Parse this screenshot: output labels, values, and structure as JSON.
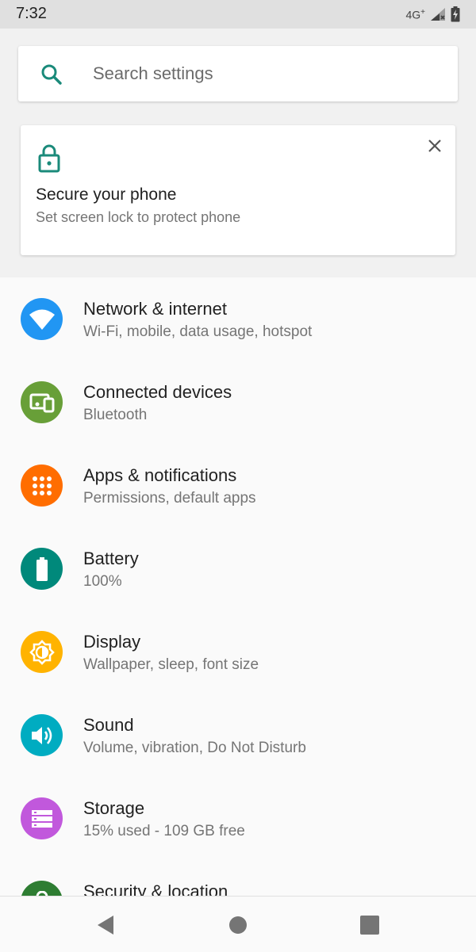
{
  "status_bar": {
    "time": "7:32",
    "network": "4G"
  },
  "search": {
    "placeholder": "Search settings",
    "icon": "search-icon"
  },
  "suggestion": {
    "icon": "lock-icon",
    "title": "Secure your phone",
    "subtitle": "Set screen lock to protect phone",
    "dismiss_icon": "close-icon"
  },
  "settings": [
    {
      "title": "Network & internet",
      "subtitle": "Wi-Fi, mobile, data usage, hotspot",
      "icon": "wifi-icon",
      "color": "#2196f3"
    },
    {
      "title": "Connected devices",
      "subtitle": "Bluetooth",
      "icon": "devices-icon",
      "color": "#689f38"
    },
    {
      "title": "Apps & notifications",
      "subtitle": "Permissions, default apps",
      "icon": "apps-grid-icon",
      "color": "#ff6d00"
    },
    {
      "title": "Battery",
      "subtitle": "100%",
      "icon": "battery-icon",
      "color": "#00897b"
    },
    {
      "title": "Display",
      "subtitle": "Wallpaper, sleep, font size",
      "icon": "brightness-icon",
      "color": "#ffb300"
    },
    {
      "title": "Sound",
      "subtitle": "Volume, vibration, Do Not Disturb",
      "icon": "volume-icon",
      "color": "#00acc1"
    },
    {
      "title": "Storage",
      "subtitle": "15% used - 109 GB free",
      "icon": "storage-icon",
      "color": "#c158dc"
    },
    {
      "title": "Security & location",
      "subtitle": "",
      "icon": "lock-icon",
      "color": "#2e7d32"
    }
  ],
  "nav": {
    "back_icon": "back-icon",
    "home_icon": "home-icon",
    "recents_icon": "recents-icon"
  }
}
